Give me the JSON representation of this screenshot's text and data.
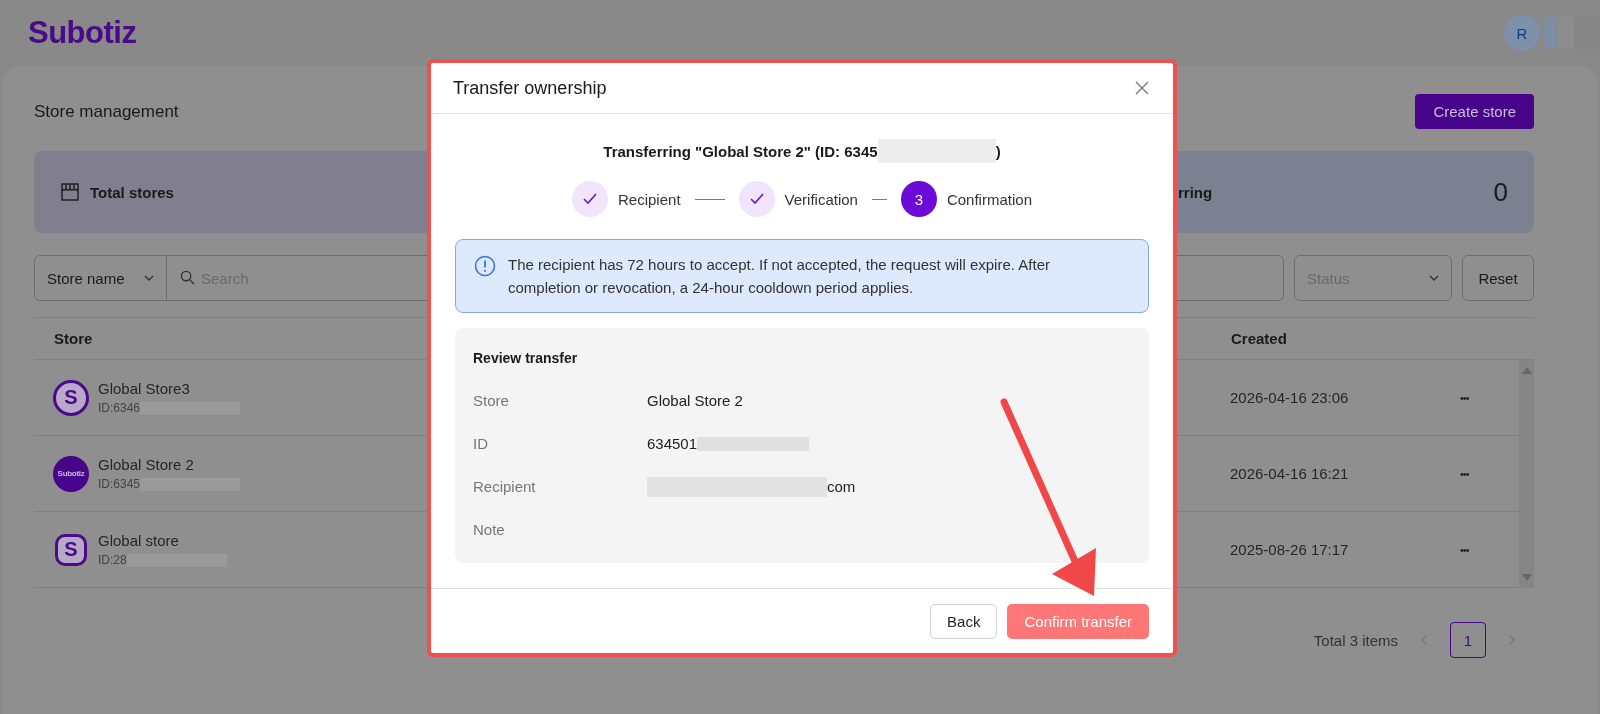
{
  "header": {
    "logo": "Subotiz",
    "avatar": "R"
  },
  "page": {
    "title": "Store management",
    "create_button": "Create store"
  },
  "stats": [
    {
      "label": "Total stores"
    },
    {
      "label": "rring",
      "value": "0"
    }
  ],
  "filters": {
    "field_select": "Store name",
    "search_placeholder": "Search",
    "status_placeholder": "Status",
    "reset": "Reset"
  },
  "table": {
    "columns": [
      "Store",
      "Created"
    ],
    "rows": [
      {
        "kind": "circle",
        "avatar_text": "S",
        "name": "Global Store3",
        "id": "ID:6346",
        "created": "2026-04-16 23:06",
        "actions": "•••"
      },
      {
        "kind": "logo",
        "avatar_text": "Subotiz",
        "name": "Global Store 2",
        "id": "ID:6345",
        "created": "2026-04-16 16:21",
        "actions": "•••"
      },
      {
        "kind": "square",
        "avatar_text": "S",
        "name": "Global store",
        "id": "ID:28",
        "created": "2025-08-26 17:17",
        "actions": "•••"
      }
    ]
  },
  "pagination": {
    "total": "Total 3 items",
    "pages": [
      {
        "label": "1",
        "selected": true
      }
    ]
  },
  "modal": {
    "title": "Transfer ownership",
    "subtitle": "Transferring \"Global Store 2\" (ID: 6345",
    "subtitle_end": ")",
    "steps": [
      {
        "label": "Recipient",
        "kind": "done"
      },
      {
        "label": "Verification",
        "kind": "done"
      },
      {
        "label": "Confirmation",
        "kind": "current",
        "number": "3"
      }
    ],
    "notice": "The recipient has 72 hours to accept. If not accepted, the request will expire. After completion or revocation, a 24-hour cooldown period applies.",
    "review": {
      "title": "Review transfer",
      "rows": [
        {
          "label": "Store",
          "value": "Global Store 2",
          "redacted": false
        },
        {
          "label": "ID",
          "value": "634501",
          "redacted": true
        },
        {
          "label": "Recipient",
          "value": "com",
          "redacted": true,
          "redact_before": true
        },
        {
          "label": "Note",
          "redacted": false
        }
      ]
    },
    "buttons": [
      {
        "label": "Back",
        "kind": "secondary"
      },
      {
        "label": "Confirm transfer",
        "kind": "primary"
      }
    ]
  }
}
